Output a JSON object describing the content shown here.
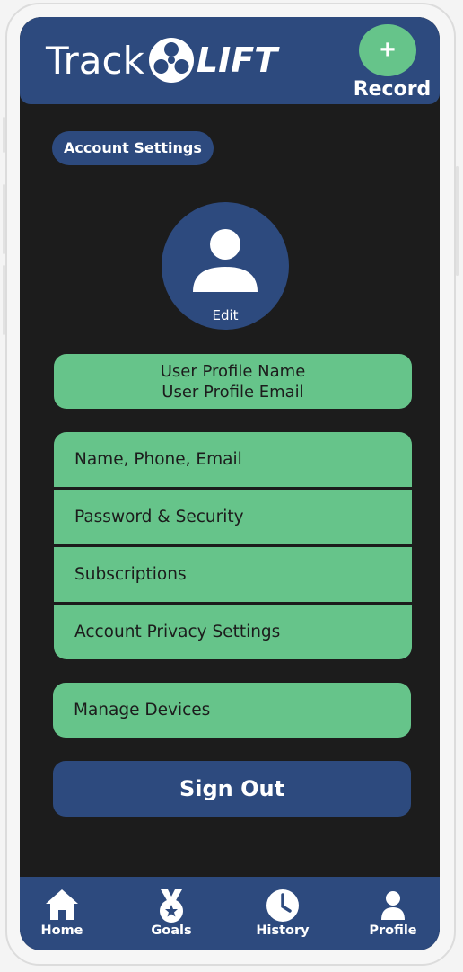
{
  "header": {
    "logo_text_track": "Track",
    "logo_text_lift": "LIFT",
    "record_icon": "plus-icon",
    "record_label": "Record"
  },
  "page": {
    "title": "Account Settings"
  },
  "avatar": {
    "icon": "person-icon",
    "edit_label": "Edit"
  },
  "profile_card": {
    "name": "User Profile Name",
    "email": "User Profile Email"
  },
  "menu": {
    "items": [
      {
        "label": "Name, Phone, Email"
      },
      {
        "label": "Password & Security"
      },
      {
        "label": "Subscriptions"
      },
      {
        "label": "Account Privacy Settings"
      }
    ]
  },
  "devices": {
    "label": "Manage Devices"
  },
  "signout": {
    "label": "Sign Out"
  },
  "nav": {
    "items": [
      {
        "label": "Home",
        "icon": "home-icon"
      },
      {
        "label": "Goals",
        "icon": "medal-icon"
      },
      {
        "label": "History",
        "icon": "clock-icon"
      },
      {
        "label": "Profile",
        "icon": "person-icon"
      }
    ]
  },
  "colors": {
    "primary": "#2d4a7e",
    "accent": "#66c48a",
    "background": "#1c1c1c",
    "text_light": "#ffffff",
    "text_dark": "#1c1c1c"
  }
}
